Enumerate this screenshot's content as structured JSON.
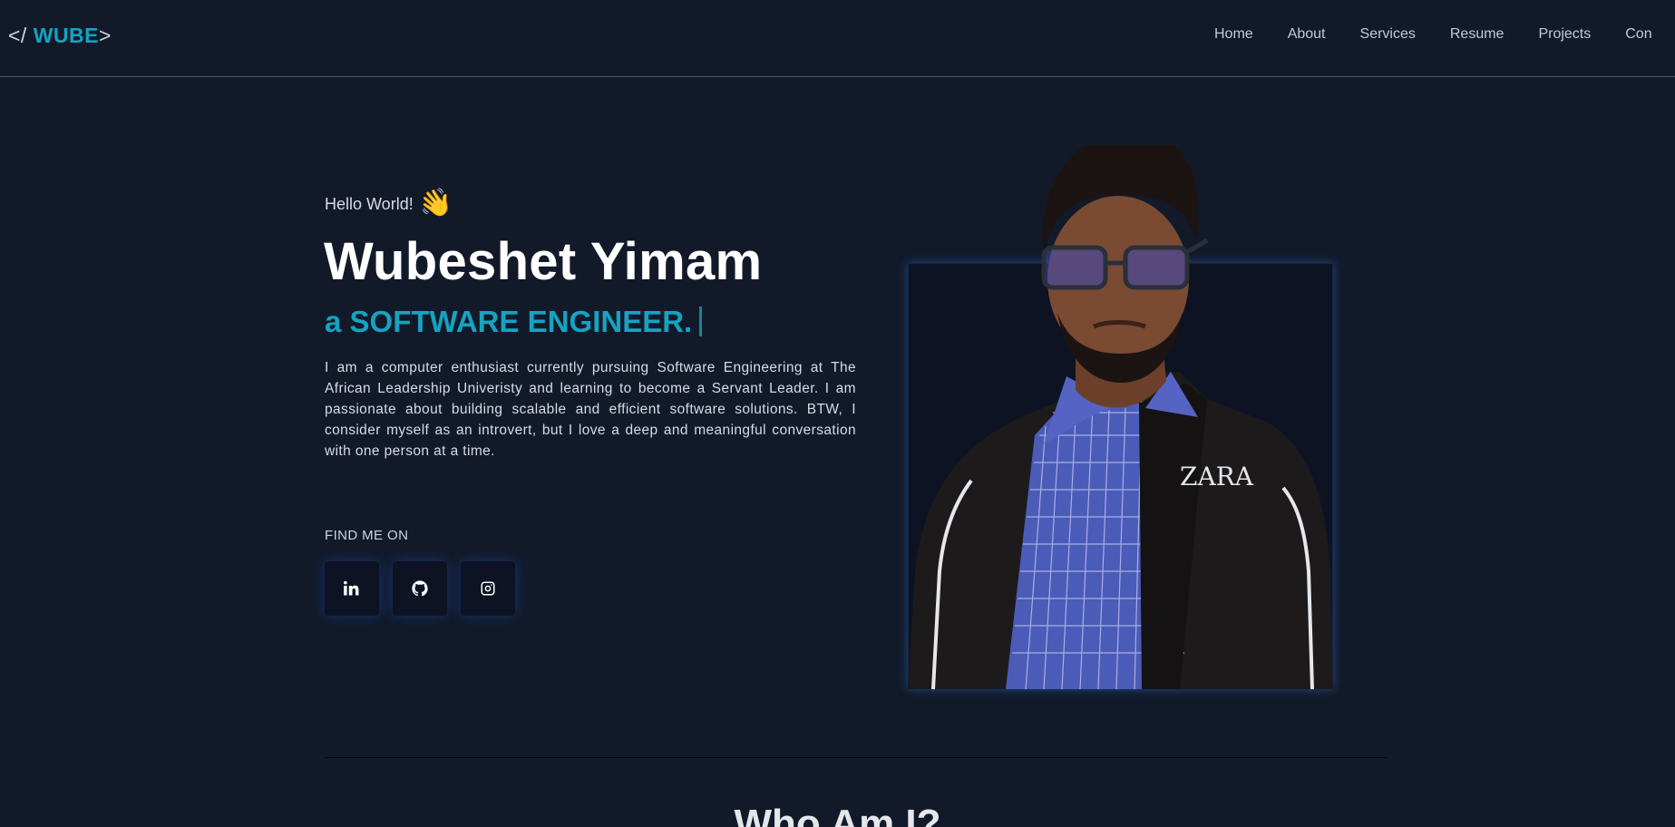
{
  "nav": {
    "logo_open": "</",
    "logo_name": "WUBE",
    "logo_close": ">",
    "links": [
      "Home",
      "About",
      "Services",
      "Resume",
      "Projects",
      "Con"
    ]
  },
  "hero": {
    "greeting": "Hello World!",
    "wave_icon": "👋",
    "name": "Wubeshet Yimam",
    "role": "a SOFTWARE ENGINEER.",
    "bio": "I am a computer enthusiast currently pursuing Software Engineering at The African Leadership Univeristy and learning to become a Servant Leader. I am passionate about building scalable and efficient software solutions. BTW, I consider myself as an introvert, but I love a deep and meaningful conversation with one person at a time.",
    "find_label": "FIND ME ON",
    "socials": [
      "linkedin-icon",
      "github-icon",
      "instagram-icon"
    ],
    "shirt_logo": "ZARA"
  },
  "section": {
    "title": "Who Am I?"
  },
  "colors": {
    "background": "#121a2a",
    "accent": "#16a3c2",
    "text": "#ffffff"
  }
}
